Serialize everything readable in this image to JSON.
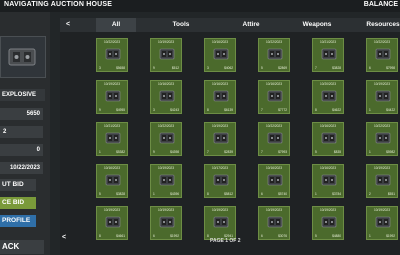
{
  "header": {
    "title": "NAVIGATING AUCTION HOUSE",
    "balance": "BALANCE"
  },
  "sidebar": {
    "item_name": "EXPLOSIVE",
    "value1": "5650",
    "value2": "2",
    "value3": "0",
    "date": "10/22/2023",
    "put_bid": "UT BID",
    "place_bid": "CE BID",
    "profile": "PROFILE",
    "back": "ACK"
  },
  "tabs": [
    "All",
    "Tools",
    "Attire",
    "Weapons",
    "Resources"
  ],
  "nav": {
    "prev": "<",
    "next": "<"
  },
  "cards": [
    {
      "date": "10/22/2023",
      "qty": "3",
      "price": "$5658"
    },
    {
      "date": "10/19/2023",
      "qty": "9",
      "price": "$512"
    },
    {
      "date": "10/16/2023",
      "qty": "3",
      "price": "$4062"
    },
    {
      "date": "10/22/2023",
      "qty": "5",
      "price": "$2869"
    },
    {
      "date": "10/21/2023",
      "qty": "7",
      "price": "$3828"
    },
    {
      "date": "10/22/2023",
      "qty": "6",
      "price": "$7998"
    },
    {
      "date": "10/19/2023",
      "qty": "9",
      "price": "$4955"
    },
    {
      "date": "10/16/2023",
      "qty": "3",
      "price": "$4243"
    },
    {
      "date": "10/16/2023",
      "qty": "8",
      "price": "$6139"
    },
    {
      "date": "10/16/2023",
      "qty": "7",
      "price": "$7772"
    },
    {
      "date": "10/20/2023",
      "qty": "8",
      "price": "$4622"
    },
    {
      "date": "10/19/2023",
      "qty": "1",
      "price": "$4422"
    },
    {
      "date": "10/21/2023",
      "qty": "1",
      "price": "$5382"
    },
    {
      "date": "10/22/2023",
      "qty": "9",
      "price": "$4398"
    },
    {
      "date": "10/19/2023",
      "qty": "7",
      "price": "$2839"
    },
    {
      "date": "10/22/2023",
      "qty": "7",
      "price": "$7993"
    },
    {
      "date": "10/16/2023",
      "qty": "5",
      "price": "$835"
    },
    {
      "date": "10/22/2023",
      "qty": "1",
      "price": "$5982"
    },
    {
      "date": "10/16/2023",
      "qty": "5",
      "price": "$3828"
    },
    {
      "date": "10/19/2023",
      "qty": "1",
      "price": "$4396"
    },
    {
      "date": "10/17/2023",
      "qty": "8",
      "price": "$5812"
    },
    {
      "date": "10/16/2023",
      "qty": "6",
      "price": "$5740"
    },
    {
      "date": "10/16/2023",
      "qty": "1",
      "price": "$3784"
    },
    {
      "date": "10/19/2023",
      "qty": "2",
      "price": "$551"
    },
    {
      "date": "10/19/2023",
      "qty": "8",
      "price": "$4661"
    },
    {
      "date": "10/19/2023",
      "qty": "6",
      "price": "$1992"
    },
    {
      "date": "10/19/2023",
      "qty": "8",
      "price": "$2941"
    },
    {
      "date": "10/19/2023",
      "qty": "6",
      "price": "$3076"
    },
    {
      "date": "10/19/2023",
      "qty": "5",
      "price": "$4880"
    },
    {
      "date": "10/19/2023",
      "qty": "1",
      "price": "$1992"
    }
  ],
  "pagination": {
    "label": "PAGE 1 OF 2"
  },
  "colors": {
    "card": "#4b6a2c",
    "place_bid": "#7a9a3a",
    "profile": "#2f6fa8"
  }
}
